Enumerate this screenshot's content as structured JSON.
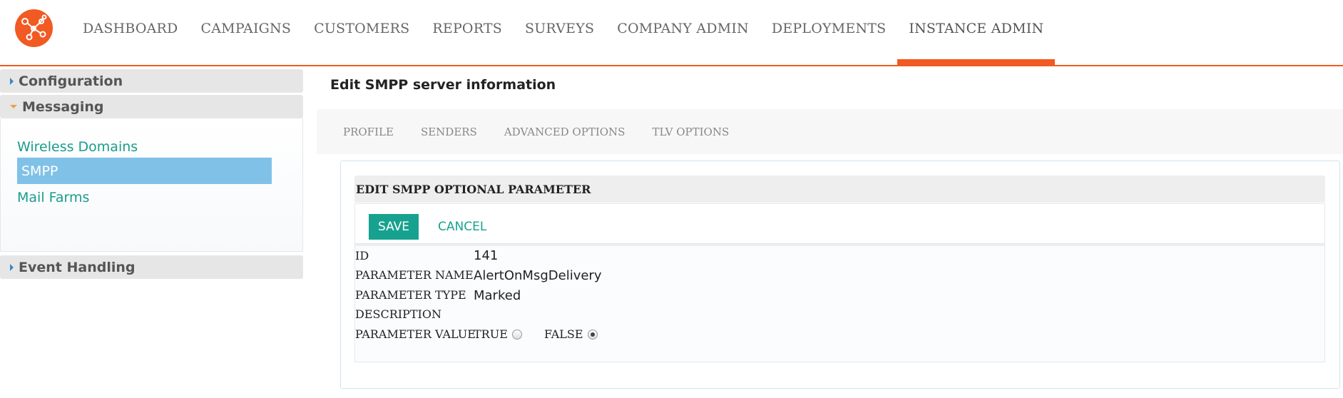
{
  "header": {
    "logo_name": "network-logo",
    "nav": [
      {
        "label": "DASHBOARD"
      },
      {
        "label": "CAMPAIGNS"
      },
      {
        "label": "CUSTOMERS"
      },
      {
        "label": "REPORTS"
      },
      {
        "label": "SURVEYS"
      },
      {
        "label": "COMPANY ADMIN"
      },
      {
        "label": "DEPLOYMENTS"
      },
      {
        "label": "INSTANCE ADMIN",
        "active": true
      }
    ],
    "accent_color": "#f15a22"
  },
  "sidebar": {
    "sections": [
      {
        "label": "Configuration",
        "expanded": false
      },
      {
        "label": "Messaging",
        "expanded": true,
        "items": [
          "Wireless Domains",
          "SMPP",
          "Mail Farms"
        ],
        "selected": "SMPP"
      },
      {
        "label": "Event Handling",
        "expanded": false
      }
    ]
  },
  "main": {
    "title": "Edit SMPP server information",
    "tabs": [
      "PROFILE",
      "SENDERS",
      "ADVANCED OPTIONS",
      "TLV OPTIONS"
    ],
    "panel": {
      "heading": "EDIT SMPP OPTIONAL PARAMETER",
      "save_label": "SAVE",
      "cancel_label": "CANCEL",
      "fields": {
        "id_label": "ID",
        "id_value": "141",
        "name_label": "PARAMETER NAME",
        "name_value": "AlertOnMsgDelivery",
        "type_label": "PARAMETER TYPE",
        "type_value": "Marked",
        "description_label": "DESCRIPTION",
        "description_value": "",
        "value_label": "PARAMETER VALUE",
        "options": [
          {
            "label": "TRUE",
            "checked": false
          },
          {
            "label": "FALSE",
            "checked": true
          }
        ]
      }
    },
    "button_color": "#17a28f",
    "selected_item_color": "#80c1e8"
  }
}
